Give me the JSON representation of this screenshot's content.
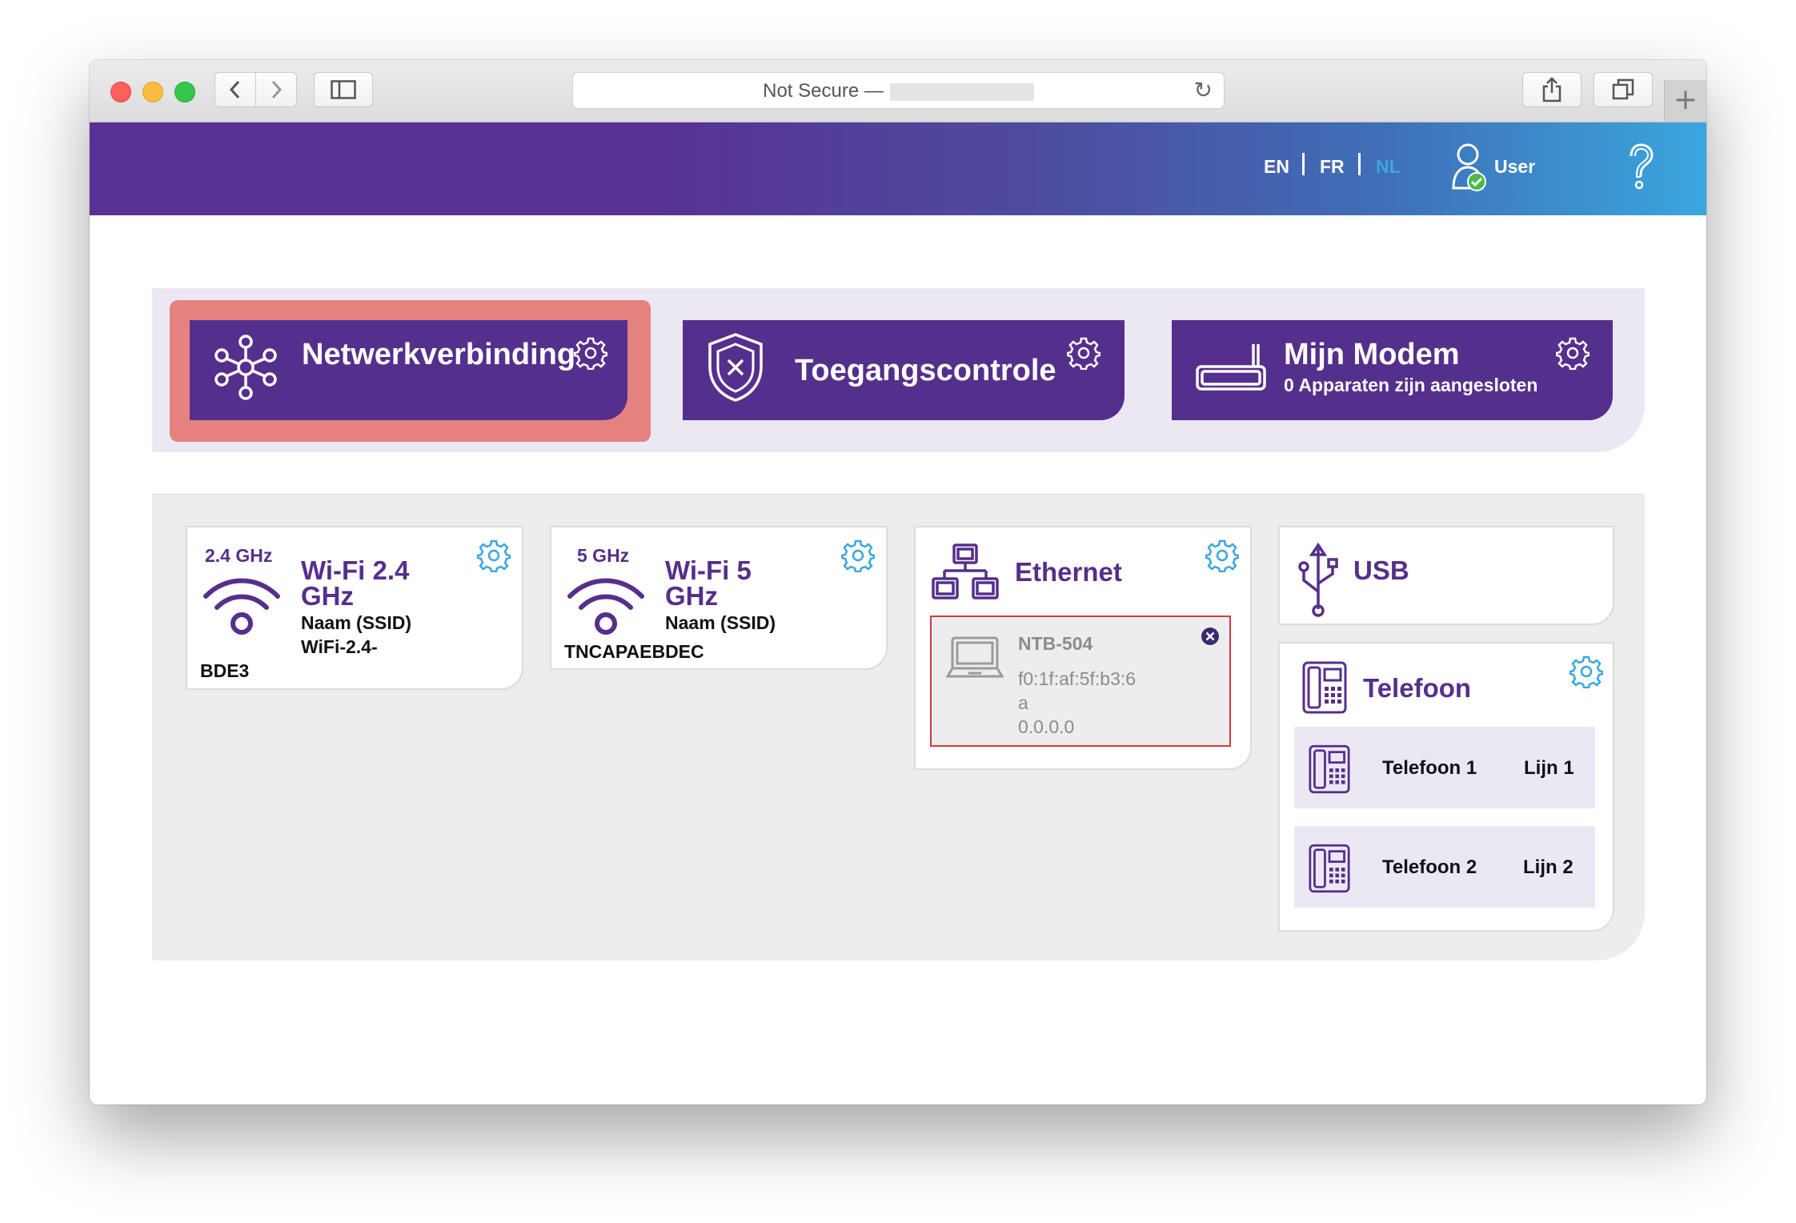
{
  "browser": {
    "address_text": "Not Secure —",
    "reload_icon": "reload-icon",
    "new_tab_label": "+"
  },
  "header": {
    "languages": [
      "EN",
      "FR",
      "NL"
    ],
    "active_language": "NL",
    "user_label": "User",
    "help_icon": "question-mark-icon"
  },
  "top_cards": {
    "network": {
      "title": "Netwerkverbinding"
    },
    "access": {
      "title": "Toegangscontrole"
    },
    "modem": {
      "title": "Mijn Modem",
      "subtitle": "0 Apparaten zijn aangesloten"
    }
  },
  "wifi24": {
    "band": "2.4 GHz",
    "title_line1": "Wi-Fi 2.4",
    "title_line2": "GHz",
    "ssid_label": "Naam (SSID)",
    "ssid_line1": "WiFi-2.4-",
    "ssid_line2": "BDE3"
  },
  "wifi5": {
    "band": "5 GHz",
    "title_line1": "Wi-Fi 5",
    "title_line2": "GHz",
    "ssid_label": "Naam (SSID)",
    "ssid": "TNCAPAEBDEC"
  },
  "ethernet": {
    "title": "Ethernet",
    "device": {
      "name": "NTB-504",
      "mac_line1": "f0:1f:af:5f:b3:6",
      "mac_line2": "a",
      "ip": "0.0.0.0"
    }
  },
  "usb": {
    "title": "USB"
  },
  "telefoon": {
    "title": "Telefoon",
    "lines": [
      {
        "name": "Telefoon 1",
        "line": "Lijn 1"
      },
      {
        "name": "Telefoon 2",
        "line": "Lijn 2"
      }
    ]
  },
  "colors": {
    "brand_purple": "#552f8c",
    "accent_blue": "#3aa6df",
    "highlight_red": "#e48280"
  }
}
